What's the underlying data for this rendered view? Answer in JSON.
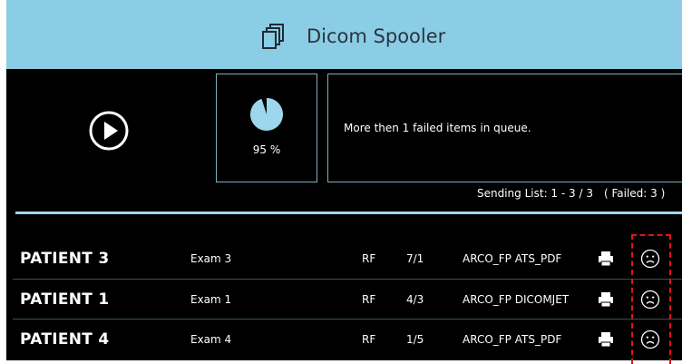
{
  "header": {
    "title": "Dicom Spooler",
    "title_icon": "documents-stack-icon",
    "background": "#8ccde6"
  },
  "controls": {
    "play_icon": "play-icon"
  },
  "progress": {
    "percent": 95,
    "label": "95 %"
  },
  "message": {
    "text": "More then 1 failed items in queue."
  },
  "sending": {
    "list_label": "Sending List: 1 - 3 / 3",
    "failed_label": "( Failed: 3 )"
  },
  "rows": [
    {
      "patient": "PATIENT 3",
      "exam": "Exam 3",
      "modality": "RF",
      "count": "7/1",
      "destination": "ARCO_FP ATS_PDF",
      "print_icon": "printer-icon",
      "status_icon": "sad-face-icon"
    },
    {
      "patient": "PATIENT 1",
      "exam": "Exam 1",
      "modality": "RF",
      "count": "4/3",
      "destination": "ARCO_FP DICOMJET",
      "print_icon": "printer-icon",
      "status_icon": "sad-face-icon"
    },
    {
      "patient": "PATIENT 4",
      "exam": "Exam 4",
      "modality": "RF",
      "count": "1/5",
      "destination": "ARCO_FP ATS_PDF",
      "print_icon": "printer-icon",
      "status_icon": "sad-face-icon"
    }
  ],
  "colors": {
    "accent": "#9cd7ee",
    "background": "#000000",
    "highlight": "#e0141c"
  }
}
